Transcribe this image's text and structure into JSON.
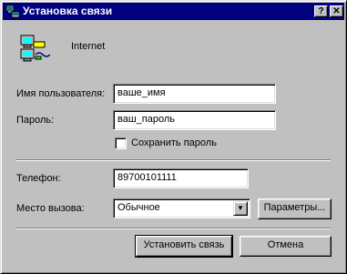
{
  "window": {
    "title": "Установка связи",
    "help_label": "?",
    "close_label": "✕"
  },
  "connection": {
    "name": "Internet"
  },
  "form": {
    "username_label": "Имя пользователя:",
    "username_value": "ваше_имя",
    "password_label": "Пароль:",
    "password_value": "ваш_пароль",
    "save_password_label": "Сохранить пароль",
    "save_password_checked": false,
    "phone_label": "Телефон:",
    "phone_value": "89700101111",
    "dial_from_label": "Место вызова:",
    "dial_from_value": "Обычное"
  },
  "buttons": {
    "params_label": "Параметры...",
    "connect_label": "Установить связь",
    "cancel_label": "Отмена"
  }
}
